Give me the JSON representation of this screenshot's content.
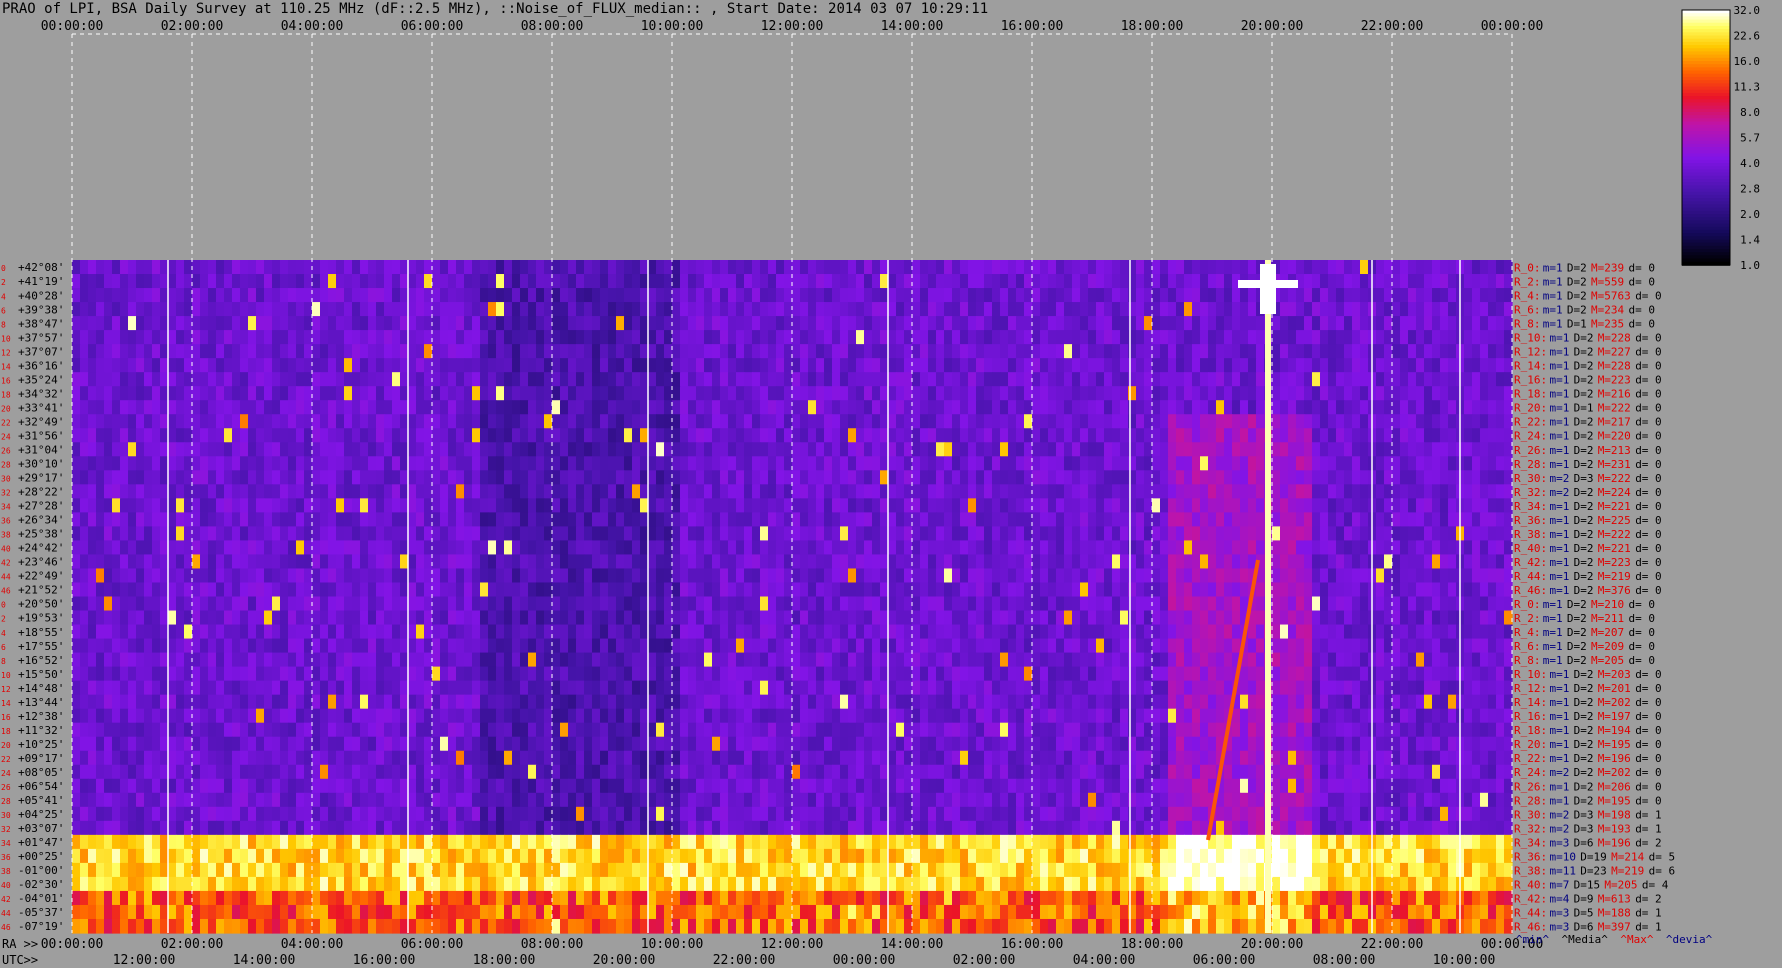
{
  "title": "PRAO of LPI, BSA Daily Survey at 110.25 MHz (dF::2.5 MHz), ::Noise_of_FLUX_median:: , Start Date: 2014 03 07 10:29:11",
  "colors": {
    "background": "#9e9e9e",
    "label_red": "#e00000",
    "label_navy": "#000080",
    "gridline": "#ffffff"
  },
  "chart_data": {
    "type": "heatmap",
    "title": "PRAO of LPI, BSA Daily Survey at 110.25 MHz (dF::2.5 MHz), ::Noise_of_FLUX_median:: , Start Date: 2014 03 07 10:29:11",
    "colormap": "gnuplot-like: black to blue to purple to red to orange to yellow to white",
    "grid": true,
    "legend_position": "right",
    "top_axis_ticks": [
      "00:00:00",
      "02:00:00",
      "04:00:00",
      "06:00:00",
      "08:00:00",
      "10:00:00",
      "12:00:00",
      "14:00:00",
      "16:00:00",
      "18:00:00",
      "20:00:00",
      "22:00:00",
      "00:00:00"
    ],
    "ra_axis_prefix": "RA >>",
    "ra_axis_ticks": [
      "00:00:00",
      "02:00:00",
      "04:00:00",
      "06:00:00",
      "08:00:00",
      "10:00:00",
      "12:00:00",
      "14:00:00",
      "16:00:00",
      "18:00:00",
      "20:00:00",
      "22:00:00",
      "00:00:00"
    ],
    "utc_axis_prefix": "UTC>>",
    "utc_axis_ticks": [
      "12:00:00",
      "14:00:00",
      "16:00:00",
      "18:00:00",
      "20:00:00",
      "22:00:00",
      "00:00:00",
      "02:00:00",
      "04:00:00",
      "06:00:00",
      "08:00:00",
      "10:00:00"
    ],
    "colorbar_ticks": [
      "32.0",
      "22.6",
      "16.0",
      "11.3",
      "8.0",
      "5.7",
      "4.0",
      "2.8",
      "2.0",
      "1.4",
      "1.0"
    ],
    "declinations": [
      "+42°08'",
      "+41°19'",
      "+40°28'",
      "+39°38'",
      "+38°47'",
      "+37°57'",
      "+37°07'",
      "+36°16'",
      "+35°24'",
      "+34°32'",
      "+33°41'",
      "+32°49'",
      "+31°56'",
      "+31°04'",
      "+30°10'",
      "+29°17'",
      "+28°22'",
      "+27°28'",
      "+26°34'",
      "+25°38'",
      "+24°42'",
      "+23°46'",
      "+22°49'",
      "+21°52'",
      "+20°50'",
      "+19°53'",
      "+18°55'",
      "+17°55'",
      "+16°52'",
      "+15°50'",
      "+14°48'",
      "+13°44'",
      "+12°38'",
      "+11°32'",
      "+10°25'",
      "+09°17'",
      "+08°05'",
      "+06°54'",
      "+05°41'",
      "+04°25'",
      "+03°07'",
      "+01°47'",
      "+00°25'",
      "-01°00'",
      "-02°30'",
      "-04°01'",
      "-05°37'",
      "-07°19'"
    ],
    "row_stats": [
      {
        "r": "R_0:",
        "m": "m=1",
        "D": "D=2",
        "M": "M=239",
        "d": "d= 0"
      },
      {
        "r": "R_2:",
        "m": "m=1",
        "D": "D=2",
        "M": "M=559",
        "d": "d= 0"
      },
      {
        "r": "R_4:",
        "m": "m=1",
        "D": "D=2",
        "M": "M=5763",
        "d": "d= 0"
      },
      {
        "r": "R_6:",
        "m": "m=1",
        "D": "D=2",
        "M": "M=234",
        "d": "d= 0"
      },
      {
        "r": "R_8:",
        "m": "m=1",
        "D": "D=1",
        "M": "M=235",
        "d": "d= 0"
      },
      {
        "r": "R_10:",
        "m": "m=1",
        "D": "D=2",
        "M": "M=228",
        "d": "d= 0"
      },
      {
        "r": "R_12:",
        "m": "m=1",
        "D": "D=2",
        "M": "M=227",
        "d": "d= 0"
      },
      {
        "r": "R_14:",
        "m": "m=1",
        "D": "D=2",
        "M": "M=228",
        "d": "d= 0"
      },
      {
        "r": "R_16:",
        "m": "m=1",
        "D": "D=2",
        "M": "M=223",
        "d": "d= 0"
      },
      {
        "r": "R_18:",
        "m": "m=1",
        "D": "D=2",
        "M": "M=216",
        "d": "d= 0"
      },
      {
        "r": "R_20:",
        "m": "m=1",
        "D": "D=1",
        "M": "M=222",
        "d": "d= 0"
      },
      {
        "r": "R_22:",
        "m": "m=1",
        "D": "D=2",
        "M": "M=217",
        "d": "d= 0"
      },
      {
        "r": "R_24:",
        "m": "m=1",
        "D": "D=2",
        "M": "M=220",
        "d": "d= 0"
      },
      {
        "r": "R_26:",
        "m": "m=1",
        "D": "D=2",
        "M": "M=213",
        "d": "d= 0"
      },
      {
        "r": "R_28:",
        "m": "m=1",
        "D": "D=2",
        "M": "M=231",
        "d": "d= 0"
      },
      {
        "r": "R_30:",
        "m": "m=2",
        "D": "D=3",
        "M": "M=222",
        "d": "d= 0"
      },
      {
        "r": "R_32:",
        "m": "m=2",
        "D": "D=2",
        "M": "M=224",
        "d": "d= 0"
      },
      {
        "r": "R_34:",
        "m": "m=1",
        "D": "D=2",
        "M": "M=221",
        "d": "d= 0"
      },
      {
        "r": "R_36:",
        "m": "m=1",
        "D": "D=2",
        "M": "M=225",
        "d": "d= 0"
      },
      {
        "r": "R_38:",
        "m": "m=1",
        "D": "D=2",
        "M": "M=222",
        "d": "d= 0"
      },
      {
        "r": "R_40:",
        "m": "m=1",
        "D": "D=2",
        "M": "M=221",
        "d": "d= 0"
      },
      {
        "r": "R_42:",
        "m": "m=1",
        "D": "D=2",
        "M": "M=223",
        "d": "d= 0"
      },
      {
        "r": "R_44:",
        "m": "m=1",
        "D": "D=2",
        "M": "M=219",
        "d": "d= 0"
      },
      {
        "r": "R_46:",
        "m": "m=1",
        "D": "D=2",
        "M": "M=376",
        "d": "d= 0"
      },
      {
        "r": "R_0:",
        "m": "m=1",
        "D": "D=2",
        "M": "M=210",
        "d": "d= 0"
      },
      {
        "r": "R_2:",
        "m": "m=1",
        "D": "D=2",
        "M": "M=211",
        "d": "d= 0"
      },
      {
        "r": "R_4:",
        "m": "m=1",
        "D": "D=2",
        "M": "M=207",
        "d": "d= 0"
      },
      {
        "r": "R_6:",
        "m": "m=1",
        "D": "D=2",
        "M": "M=209",
        "d": "d= 0"
      },
      {
        "r": "R_8:",
        "m": "m=1",
        "D": "D=2",
        "M": "M=205",
        "d": "d= 0"
      },
      {
        "r": "R_10:",
        "m": "m=1",
        "D": "D=2",
        "M": "M=203",
        "d": "d= 0"
      },
      {
        "r": "R_12:",
        "m": "m=1",
        "D": "D=2",
        "M": "M=201",
        "d": "d= 0"
      },
      {
        "r": "R_14:",
        "m": "m=1",
        "D": "D=2",
        "M": "M=202",
        "d": "d= 0"
      },
      {
        "r": "R_16:",
        "m": "m=1",
        "D": "D=2",
        "M": "M=197",
        "d": "d= 0"
      },
      {
        "r": "R_18:",
        "m": "m=1",
        "D": "D=2",
        "M": "M=194",
        "d": "d= 0"
      },
      {
        "r": "R_20:",
        "m": "m=1",
        "D": "D=2",
        "M": "M=195",
        "d": "d= 0"
      },
      {
        "r": "R_22:",
        "m": "m=1",
        "D": "D=2",
        "M": "M=196",
        "d": "d= 0"
      },
      {
        "r": "R_24:",
        "m": "m=2",
        "D": "D=2",
        "M": "M=202",
        "d": "d= 0"
      },
      {
        "r": "R_26:",
        "m": "m=1",
        "D": "D=2",
        "M": "M=206",
        "d": "d= 0"
      },
      {
        "r": "R_28:",
        "m": "m=1",
        "D": "D=2",
        "M": "M=195",
        "d": "d= 0"
      },
      {
        "r": "R_30:",
        "m": "m=2",
        "D": "D=3",
        "M": "M=198",
        "d": "d= 1"
      },
      {
        "r": "R_32:",
        "m": "m=2",
        "D": "D=3",
        "M": "M=193",
        "d": "d= 1"
      },
      {
        "r": "R_34:",
        "m": "m=3",
        "D": "D=6",
        "M": "M=196",
        "d": "d= 2"
      },
      {
        "r": "R_36:",
        "m": "m=10",
        "D": "D=19",
        "M": "M=214",
        "d": "d= 5"
      },
      {
        "r": "R_38:",
        "m": "m=11",
        "D": "D=23",
        "M": "M=219",
        "d": "d= 6"
      },
      {
        "r": "R_40:",
        "m": "m=7",
        "D": "D=15",
        "M": "M=205",
        "d": "d= 4"
      },
      {
        "r": "R_42:",
        "m": "m=4",
        "D": "D=9",
        "M": "M=613",
        "d": "d= 2"
      },
      {
        "r": "R_44:",
        "m": "m=3",
        "D": "D=5",
        "M": "M=188",
        "d": "d= 1"
      },
      {
        "r": "R_46:",
        "m": "m=3",
        "D": "D=6",
        "M": "M=397",
        "d": "d= 1"
      }
    ],
    "stats_legend": [
      "^min^",
      "^Media^",
      "^Max^",
      "^devia^"
    ],
    "beam_numbers": [
      "0",
      "2",
      "4",
      "6",
      "8",
      "10",
      "12",
      "14",
      "16",
      "18",
      "20",
      "22",
      "24",
      "26",
      "28",
      "30",
      "32",
      "34",
      "36",
      "38",
      "40",
      "42",
      "44",
      "46",
      "0",
      "2",
      "4",
      "6",
      "8",
      "10",
      "12",
      "14",
      "16",
      "18",
      "20",
      "22",
      "24",
      "26",
      "28",
      "30",
      "32",
      "34",
      "36",
      "38",
      "40",
      "42",
      "44",
      "46"
    ]
  }
}
